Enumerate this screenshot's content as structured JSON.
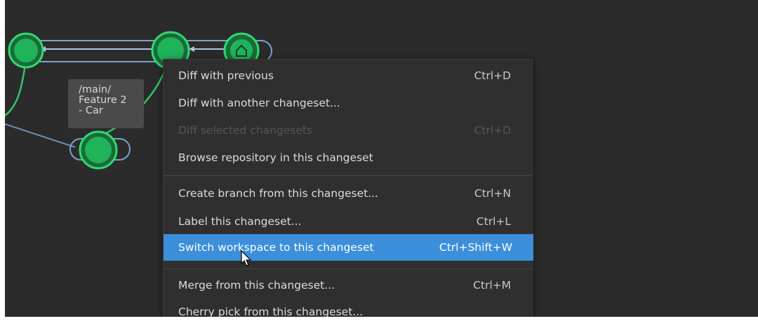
{
  "graph": {
    "branch_tag_lines": [
      "/main/",
      "Feature 2",
      "- Car"
    ],
    "colors": {
      "node_fill": "#1fb35a",
      "node_ring": "#2ddc6e",
      "link_line": "#6a8fb8",
      "branch_line": "#35c46a"
    }
  },
  "context_menu": {
    "items": [
      {
        "label": "Diff with previous",
        "shortcut": "Ctrl+D",
        "enabled": true
      },
      {
        "label": "Diff with another changeset...",
        "shortcut": "",
        "enabled": true
      },
      {
        "label": "Diff selected changesets",
        "shortcut": "Ctrl+D",
        "enabled": false
      },
      {
        "label": "Browse repository in this changeset",
        "shortcut": "",
        "enabled": true
      },
      {
        "label": "Create branch from this changeset...",
        "shortcut": "Ctrl+N",
        "enabled": true
      },
      {
        "label": "Label this changeset...",
        "shortcut": "Ctrl+L",
        "enabled": true
      },
      {
        "label": "Switch workspace to this changeset",
        "shortcut": "Ctrl+Shift+W",
        "enabled": true,
        "highlighted": true
      },
      {
        "label": "Merge from this changeset...",
        "shortcut": "Ctrl+M",
        "enabled": true
      },
      {
        "label": "Cherry pick from this changeset...",
        "shortcut": "",
        "enabled": true
      }
    ],
    "highlight_color": "#3b8fdb"
  }
}
